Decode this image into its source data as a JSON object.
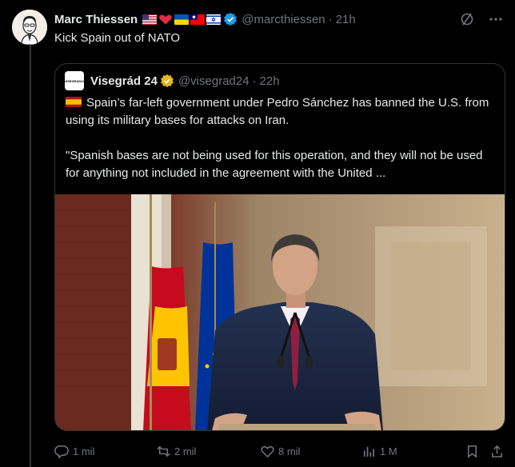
{
  "post": {
    "author_name": "Marc Thiessen",
    "author_handle": "@marcthiessen",
    "separator": "·",
    "time": "21h",
    "text": "Kick Spain out of NATO",
    "flags": [
      "us-flag",
      "red-heart",
      "ukraine-flag",
      "taiwan-flag",
      "israel-flag"
    ]
  },
  "quote": {
    "author_name": "Visegrád 24",
    "author_handle": "@visegrad24",
    "separator": "·",
    "time": "22h",
    "avatar_text": "VISEGRAD24",
    "line1": "Spain’s far-left government under Pedro Sánchez has banned the U.S. from using its military bases for attacks on Iran.",
    "line2": "\"Spanish bases are not being used for this operation, and they will not be used for anything not included in the agreement with the United ..."
  },
  "actions": {
    "replies": "1 mil",
    "reposts": "2 mil",
    "likes": "8 mil",
    "views": "1 M"
  },
  "colors": {
    "background": "#000000",
    "text": "#e7e9ea",
    "muted": "#71767b",
    "border": "#2f3336",
    "verified_blue": "#1d9bf0",
    "verified_gold": "#e2b719"
  }
}
